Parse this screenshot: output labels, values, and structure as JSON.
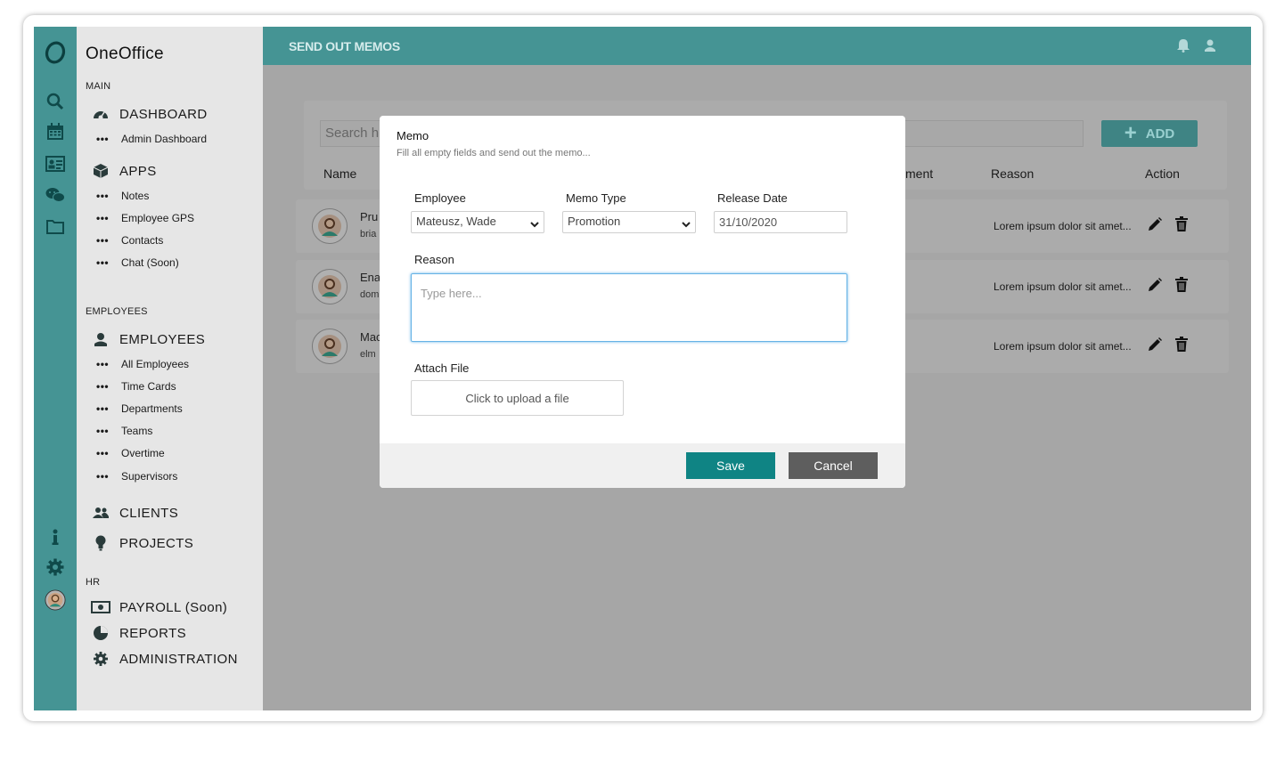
{
  "app": {
    "brand": "OneOffice",
    "accent_color": "#459494"
  },
  "rail": {
    "icons": [
      "logo-icon",
      "search-icon",
      "calendar-icon",
      "id-card-icon",
      "chat-icon",
      "folder-icon",
      "info-icon",
      "gear-icon",
      "avatar"
    ]
  },
  "nav": {
    "sections": {
      "main": "MAIN",
      "employees": "EMPLOYEES",
      "hr": "HR"
    },
    "dashboard": {
      "label": "DASHBOARD",
      "subs": [
        "Admin Dashboard"
      ]
    },
    "apps": {
      "label": "APPS",
      "subs": [
        "Notes",
        "Employee GPS",
        "Contacts",
        "Chat (Soon)"
      ]
    },
    "employees": {
      "label": "EMPLOYEES",
      "subs": [
        "All Employees",
        "Time Cards",
        "Departments",
        "Teams",
        "Overtime",
        "Supervisors"
      ]
    },
    "clients": {
      "label": "CLIENTS"
    },
    "projects": {
      "label": "PROJECTS"
    },
    "payroll": {
      "label": "PAYROLL (Soon)"
    },
    "reports": {
      "label": "REPORTS"
    },
    "administration": {
      "label": "ADMINISTRATION"
    }
  },
  "header": {
    "title": "SEND OUT MEMOS"
  },
  "list": {
    "search_placeholder": "Search h",
    "add_label": "ADD",
    "columns": {
      "name": "Name",
      "attachment": "ment",
      "reason": "Reason",
      "action": "Action"
    },
    "rows": [
      {
        "name": "Pru",
        "email": "bria",
        "reason": "Lorem ipsum dolor sit amet..."
      },
      {
        "name": "Ena",
        "email": "dom",
        "reason": "Lorem ipsum dolor sit amet..."
      },
      {
        "name": "Mac",
        "email": "elm",
        "reason": "Lorem ipsum dolor sit amet..."
      }
    ]
  },
  "modal": {
    "title": "Memo",
    "subtitle": "Fill all empty fields and send out the memo...",
    "employee_label": "Employee",
    "employee_value": "Mateusz, Wade",
    "memo_type_label": "Memo Type",
    "memo_type_value": "Promotion",
    "release_date_label": "Release Date",
    "release_date_value": "31/10/2020",
    "reason_label": "Reason",
    "reason_placeholder": "Type here...",
    "attach_label": "Attach File",
    "upload_label": "Click to upload a file",
    "save_label": "Save",
    "cancel_label": "Cancel"
  }
}
